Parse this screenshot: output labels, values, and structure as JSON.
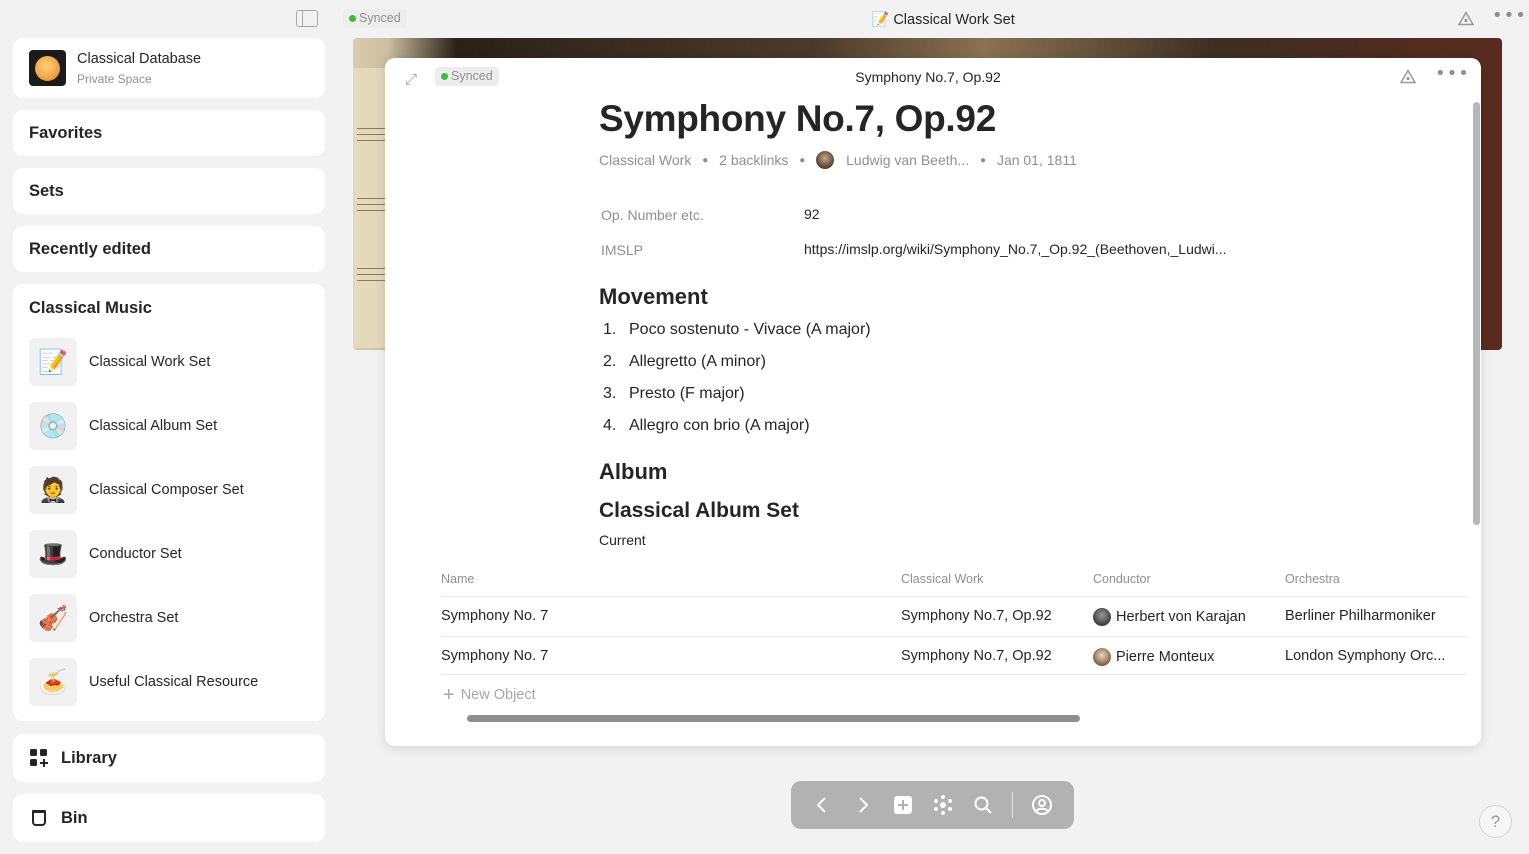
{
  "sidebar": {
    "toggle_icon": "sidebar-toggle-icon",
    "space": {
      "name": "Classical Database",
      "subtitle": "Private Space"
    },
    "sections": {
      "favorites": "Favorites",
      "sets": "Sets",
      "recently_edited": "Recently edited"
    },
    "widget": {
      "title": "Classical Music",
      "items": [
        {
          "label": "Classical Work Set",
          "icon": "📝"
        },
        {
          "label": "Classical Album Set",
          "icon": "💿"
        },
        {
          "label": "Classical Composer Set",
          "icon": "🤵"
        },
        {
          "label": "Conductor Set",
          "icon": "🎩"
        },
        {
          "label": "Orchestra Set",
          "icon": "🎻"
        },
        {
          "label": "Useful Classical Resource",
          "icon": "🍝"
        }
      ]
    },
    "library_label": "Library",
    "bin_label": "Bin"
  },
  "topbar": {
    "status": "Synced",
    "title": "📝 Classical Work Set",
    "graph_icon": "graph-icon",
    "more_icon": "more-icon"
  },
  "panel": {
    "status": "Synced",
    "header_title": "Symphony No.7, Op.92",
    "title": "Symphony No.7, Op.92",
    "meta": {
      "type": "Classical Work",
      "backlinks": "2 backlinks",
      "creator": "Ludwig van Beeth...",
      "date": "Jan 01, 1811"
    },
    "relations": [
      {
        "key": "Op. Number etc.",
        "value": "92"
      },
      {
        "key": "IMSLP",
        "value": "https://imslp.org/wiki/Symphony_No.7,_Op.92_(Beethoven,_Ludwi..."
      }
    ],
    "movement_heading": "Movement",
    "movements": [
      {
        "num": "1.",
        "text": "Poco sostenuto - Vivace (A major)"
      },
      {
        "num": "2.",
        "text": "Allegretto (A minor)"
      },
      {
        "num": "3.",
        "text": "Presto (F major)"
      },
      {
        "num": "4.",
        "text": "Allegro con brio (A major)"
      }
    ],
    "album_heading": "Album",
    "inline_set": {
      "title": "Classical Album Set",
      "view": "Current",
      "columns": [
        "Name",
        "Classical Work",
        "Conductor",
        "Orchestra"
      ],
      "rows": [
        {
          "name": "Symphony No. 7",
          "work": "Symphony No.7, Op.92",
          "conductor": "Herbert von Karajan",
          "orchestra": "Berliner Philharmoniker"
        },
        {
          "name": "Symphony No. 7",
          "work": "Symphony No.7, Op.92",
          "conductor": "Pierre Monteux",
          "orchestra": "London Symphony Orc..."
        }
      ],
      "new_object": "New Object"
    }
  },
  "navbar": {
    "icons": [
      "back-icon",
      "forward-icon",
      "add-icon",
      "graph-view-icon",
      "search-icon",
      "profile-icon"
    ]
  },
  "help_label": "?",
  "colors": {
    "synced": "#3dbb3d",
    "navbar": "#b2b2b2",
    "sidebar_bg": "#f2f2f2"
  }
}
